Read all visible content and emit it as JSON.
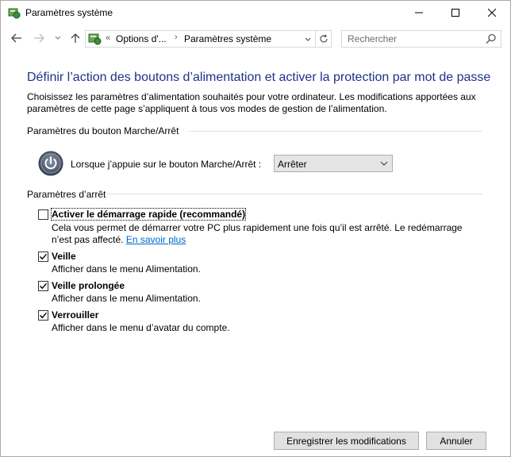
{
  "window": {
    "title": "Paramètres système"
  },
  "address": {
    "crumb_separator": "«",
    "crumbs": [
      "Options d'...",
      "Paramètres système"
    ],
    "crumb_arrow": "›"
  },
  "search": {
    "placeholder": "Rechercher"
  },
  "main": {
    "heading": "Définir l’action des boutons d’alimentation et activer la protection par mot de passe",
    "intro": "Choisissez les paramètres d’alimentation souhaités pour votre ordinateur. Les modifications apportées aux paramètres de cette page s’appliquent à tous vos modes de gestion de l’alimentation.",
    "power_section": {
      "label": "Paramètres du bouton Marche/Arrêt",
      "row_label": "Lorsque j’appuie sur le bouton Marche/Arrêt :",
      "selected_value": "Arrêter"
    },
    "shutdown_section": {
      "label": "Paramètres d’arrêt",
      "options": [
        {
          "label": "Activer le démarrage rapide (recommandé)",
          "checked": false,
          "description": "Cela vous permet de démarrer votre PC plus rapidement une fois qu’il est arrêté. Le redémarrage n’est pas affecté.",
          "link": "En savoir plus"
        },
        {
          "label": "Veille",
          "checked": true,
          "description": "Afficher dans le menu Alimentation."
        },
        {
          "label": "Veille prolongée",
          "checked": true,
          "description": "Afficher dans le menu Alimentation."
        },
        {
          "label": "Verrouiller",
          "checked": true,
          "description": "Afficher dans le menu d’avatar du compte."
        }
      ]
    }
  },
  "footer": {
    "save_label": "Enregistrer les modifications",
    "cancel_label": "Annuler"
  },
  "colors": {
    "heading": "#1e3287",
    "link": "#0066cc"
  }
}
